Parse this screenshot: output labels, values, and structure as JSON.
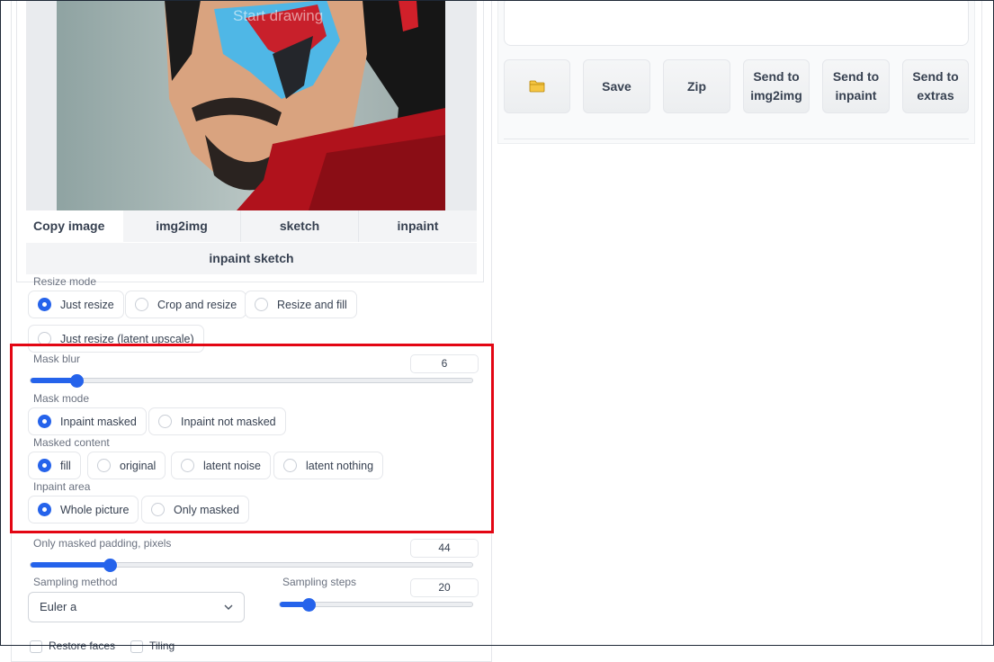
{
  "image_panel": {
    "canvas_hint": "Start drawing",
    "copy_label": "Copy image to:",
    "copy_targets": [
      "img2img",
      "sketch",
      "inpaint",
      "inpaint sketch"
    ]
  },
  "resize_mode": {
    "label": "Resize mode",
    "options": [
      "Just resize",
      "Crop and resize",
      "Resize and fill",
      "Just resize (latent upscale)"
    ],
    "selected": "Just resize"
  },
  "mask_blur": {
    "label": "Mask blur",
    "value": "6",
    "fraction": 0.1
  },
  "mask_mode": {
    "label": "Mask mode",
    "options": [
      "Inpaint masked",
      "Inpaint not masked"
    ],
    "selected": "Inpaint masked"
  },
  "masked_content": {
    "label": "Masked content",
    "options": [
      "fill",
      "original",
      "latent noise",
      "latent nothing"
    ],
    "selected": "fill"
  },
  "inpaint_area": {
    "label": "Inpaint area",
    "options": [
      "Whole picture",
      "Only masked"
    ],
    "selected": "Whole picture"
  },
  "only_masked_padding": {
    "label": "Only masked padding, pixels",
    "value": "44",
    "fraction": 0.17
  },
  "sampling_method": {
    "label": "Sampling method",
    "value": "Euler a"
  },
  "sampling_steps": {
    "label": "Sampling steps",
    "value": "20",
    "fraction": 0.15
  },
  "checkboxes": [
    "Restore faces",
    "Tiling"
  ],
  "output_actions": {
    "open_folder_icon": "folder-icon",
    "buttons": [
      "Save",
      "Zip",
      "Send to img2img",
      "Send to inpaint",
      "Send to extras"
    ]
  },
  "colors": {
    "accent": "#2563eb",
    "highlight": "#e30613"
  }
}
